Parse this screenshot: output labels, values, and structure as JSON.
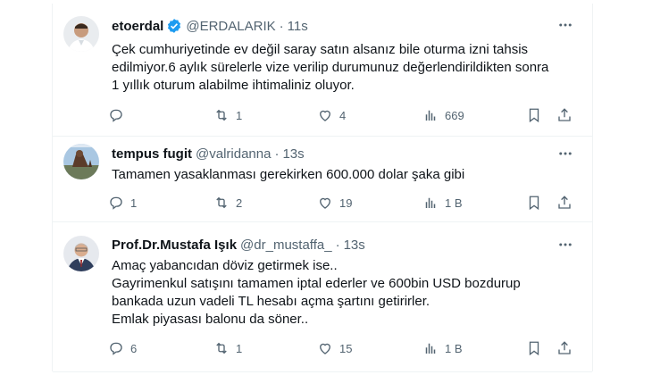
{
  "tweets": [
    {
      "name": "etoerdal",
      "handle": "@ERDALARIK",
      "time": "11s",
      "verified": true,
      "lines": [
        "Çek cumhuriyetinde ev değil saray satın alsanız bile oturma izni tahsis",
        "edilmiyor.6 aylık sürelerle vize verilip durumunuz değerlendirildikten sonra",
        "1 yıllık oturum alabilme ihtimaliniz oluyor."
      ],
      "reply_count": "",
      "retweet_count": "1",
      "like_count": "4",
      "view_count": "669"
    },
    {
      "name": "tempus fugit",
      "handle": "@valridanna",
      "time": "13s",
      "verified": false,
      "lines": [
        "Tamamen yasaklanması gerekirken 600.000 dolar şaka gibi"
      ],
      "reply_count": "1",
      "retweet_count": "2",
      "like_count": "19",
      "view_count": "1 B"
    },
    {
      "name": "Prof.Dr.Mustafa Işık",
      "handle": "@dr_mustaffa_",
      "time": "13s",
      "verified": false,
      "lines": [
        "Amaç yabancıdan döviz getirmek ise..",
        "Gayrimenkul satışını tamamen iptal ederler ve 600bin USD bozdurup",
        "bankada uzun vadeli TL hesabı açma şartını getirirler.",
        "Emlak piyasası balonu da söner.."
      ],
      "reply_count": "6",
      "retweet_count": "1",
      "like_count": "15",
      "view_count": "1 B"
    }
  ],
  "separator": "·",
  "colors": {
    "verified": "#1d9bf0",
    "muted": "#536471",
    "text": "#0f1419"
  },
  "icons": [
    "reply-icon",
    "retweet-icon",
    "like-icon",
    "views-icon",
    "bookmark-icon",
    "share-icon",
    "more-icon",
    "verified-icon"
  ]
}
